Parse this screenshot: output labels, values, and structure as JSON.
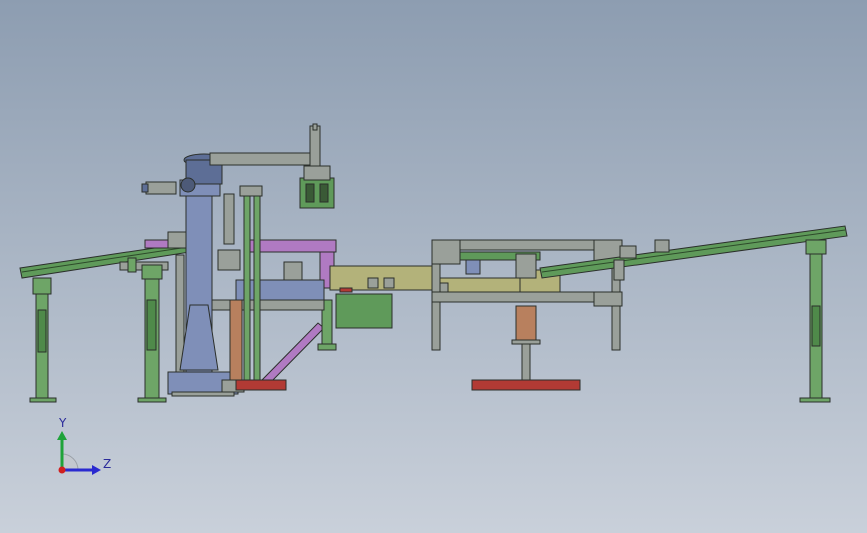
{
  "colors": {
    "background_top": "#8d9db1",
    "background_bottom": "#c9d0da",
    "conveyor_green": "#5f9a5a",
    "leg_green": "#6ea567",
    "frame_grey": "#9aa09a",
    "steel_blue": "#7f8fb8",
    "magenta": "#b07ac2",
    "olive": "#b3b27a",
    "red": "#b23a34",
    "copper": "#b8805e",
    "outline": "#2b2f2b",
    "axis_y": "#1fa33a",
    "axis_z": "#2a2ad0",
    "origin": "#d02020"
  },
  "axes": {
    "y_label": "Y",
    "z_label": "Z"
  }
}
